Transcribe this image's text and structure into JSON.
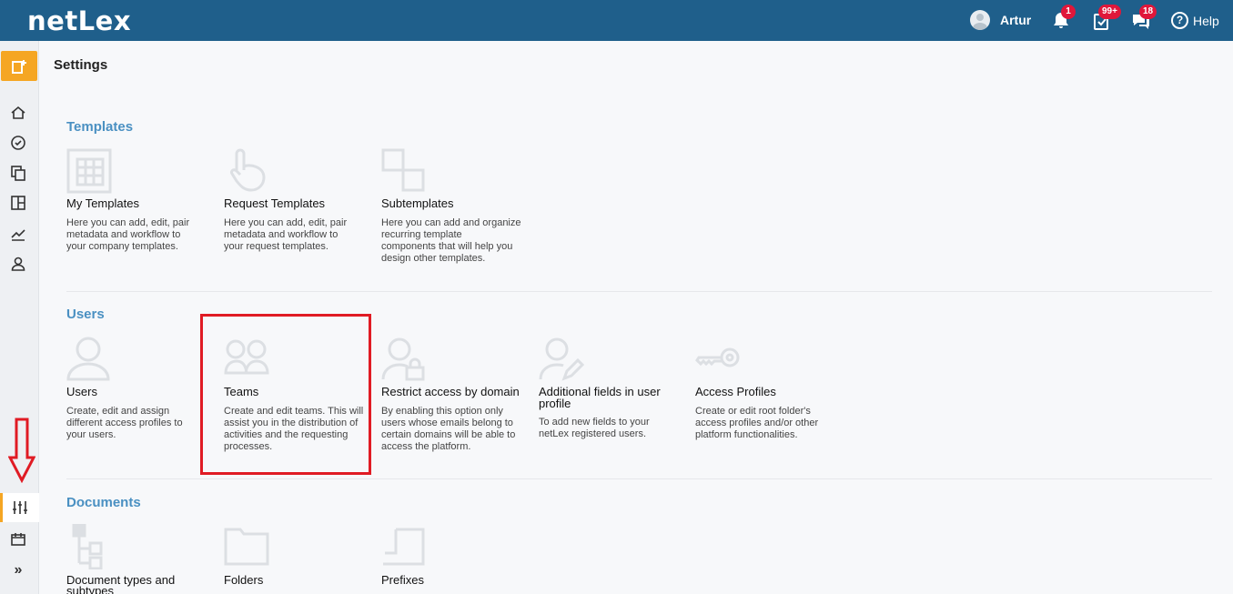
{
  "header": {
    "logo": "netLex",
    "user_name": "Artur",
    "notifications_badge": "1",
    "tasks_badge": "99+",
    "messages_badge": "18",
    "help_label": "Help",
    "help_icon_glyph": "?"
  },
  "sidebar": {
    "add_icon": "add-document-icon",
    "items": [
      "home-icon",
      "dashboard-icon",
      "documents-icon",
      "board-icon",
      "analytics-icon",
      "user-icon"
    ],
    "bottom_items": [
      "settings-icon",
      "calendar-icon"
    ],
    "expand_glyph": "»"
  },
  "page": {
    "title": "Settings"
  },
  "sections": {
    "templates": {
      "title": "Templates",
      "cards": [
        {
          "title": "My Templates",
          "description": [
            "Here you can add, edit, pair",
            "metadata and workflow to",
            "your company templates."
          ],
          "icon": "template-grid-icon"
        },
        {
          "title": "Request Templates",
          "description": [
            "Here you can add, edit, pair",
            "metadata and workflow to",
            "your request templates."
          ],
          "icon": "hand-pointer-icon"
        },
        {
          "title": "Subtemplates",
          "description": [
            "Here you can add and organize",
            "recurring template",
            "components that will help you",
            "design other templates."
          ],
          "icon": "subtemplates-icon"
        }
      ]
    },
    "users": {
      "title": "Users",
      "cards": [
        {
          "title": "Users",
          "description": [
            "Create, edit and assign",
            "different access profiles to",
            "your users."
          ],
          "icon": "user-icon"
        },
        {
          "title": "Teams",
          "description": [
            "Create and edit teams. This will",
            "assist you in the distribution of",
            "activities and the requesting",
            "processes."
          ],
          "icon": "team-icon"
        },
        {
          "title": "Restrict access by domain",
          "description": [
            "By enabling this option only",
            "users whose emails belong to",
            "certain domains will be able to",
            "access the platform."
          ],
          "icon": "user-lock-icon"
        },
        {
          "title": [
            "Additional fields in user",
            "profile"
          ],
          "description": [
            "To add new fields to your",
            "netLex registered users."
          ],
          "icon": "user-edit-icon"
        },
        {
          "title": "Access Profiles",
          "description": [
            "Create or edit root folder's",
            "access profiles and/or other",
            "platform functionalities."
          ],
          "icon": "key-icon"
        }
      ]
    },
    "documents": {
      "title": "Documents",
      "cards": [
        {
          "title": [
            "Document types and",
            "subtypes"
          ],
          "icon": "hierarchy-icon"
        },
        {
          "title": "Folders",
          "icon": "folder-icon"
        },
        {
          "title": "Prefixes",
          "icon": "prefix-document-icon"
        }
      ]
    }
  },
  "colors": {
    "topbar": "#1f5f8b",
    "accent": "#f5a623",
    "section_title": "#4a90c2",
    "badge": "#e0173a",
    "annotation": "#e01b24"
  }
}
